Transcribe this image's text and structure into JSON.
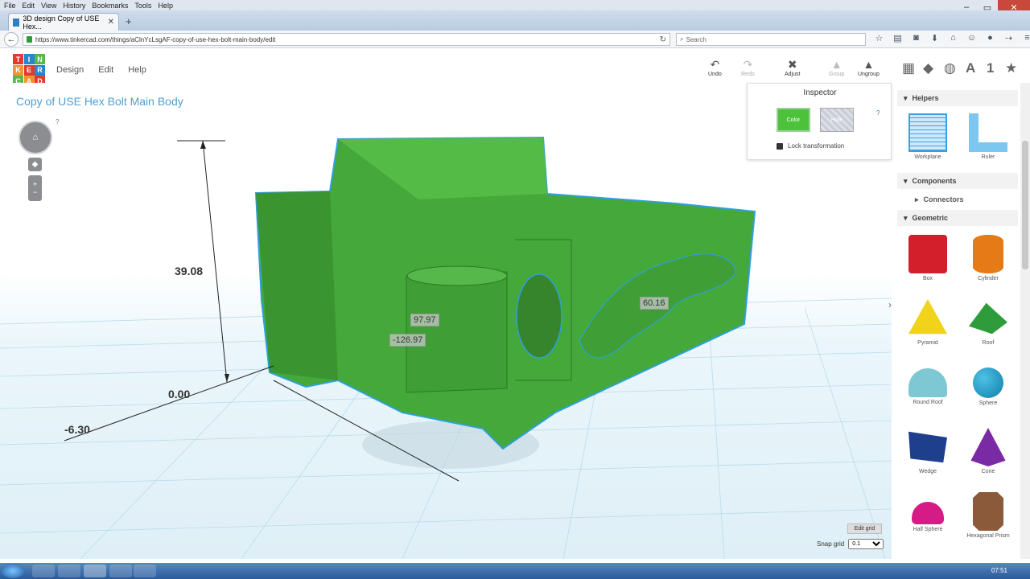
{
  "browser": {
    "menu": [
      "File",
      "Edit",
      "View",
      "History",
      "Bookmarks",
      "Tools",
      "Help"
    ],
    "tab_title": "3D design Copy of USE Hex...",
    "url": "https://www.tinkercad.com/things/aClnYcLsgAF-copy-of-use-hex-bolt-main-body/edit",
    "search_placeholder": "Search"
  },
  "app": {
    "logo_letters": [
      "T",
      "I",
      "N",
      "K",
      "E",
      "R",
      "C",
      "A",
      "D"
    ],
    "menu": [
      "Design",
      "Edit",
      "Help"
    ],
    "toolbar": {
      "undo": "Undo",
      "redo": "Redo",
      "adjust": "Adjust",
      "group": "Group",
      "ungroup": "Ungroup"
    },
    "design_title": "Copy of USE Hex Bolt Main Body",
    "help_mark": "?"
  },
  "dimensions": {
    "height": "39.08",
    "zero": "0.00",
    "neg_x": "-6.30",
    "box1": "97.97",
    "box2": "-126.97",
    "box3": "60.16"
  },
  "inspector": {
    "title": "Inspector",
    "color_label": "Color",
    "hole_label": "Hole",
    "help": "?",
    "lock": "Lock transformation"
  },
  "grid": {
    "edit": "Edit grid",
    "snap_label": "Snap grid",
    "snap_value": "0.1"
  },
  "panel": {
    "helpers": "Helpers",
    "helper_items": [
      "Workplane",
      "Ruler"
    ],
    "components": "Components",
    "connectors": "Connectors",
    "geometric": "Geometric",
    "shapes": [
      "Box",
      "Cylinder",
      "Pyramid",
      "Roof",
      "Round Roof",
      "Sphere",
      "Wedge",
      "Cone",
      "Half Sphere",
      "Hexagonal Prism"
    ]
  },
  "taskbar": {
    "time": "07:51"
  },
  "colors": {
    "model_green": "#44a83a",
    "accent_blue": "#4f9fd0"
  }
}
